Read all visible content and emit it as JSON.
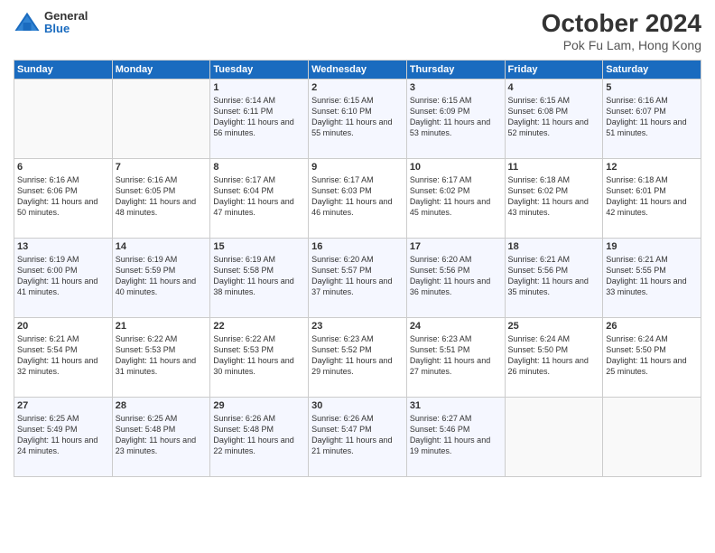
{
  "logo": {
    "general": "General",
    "blue": "Blue"
  },
  "title": "October 2024",
  "location": "Pok Fu Lam, Hong Kong",
  "days_of_week": [
    "Sunday",
    "Monday",
    "Tuesday",
    "Wednesday",
    "Thursday",
    "Friday",
    "Saturday"
  ],
  "weeks": [
    [
      {
        "day": "",
        "sunrise": "",
        "sunset": "",
        "daylight": ""
      },
      {
        "day": "",
        "sunrise": "",
        "sunset": "",
        "daylight": ""
      },
      {
        "day": "1",
        "sunrise": "Sunrise: 6:14 AM",
        "sunset": "Sunset: 6:11 PM",
        "daylight": "Daylight: 11 hours and 56 minutes."
      },
      {
        "day": "2",
        "sunrise": "Sunrise: 6:15 AM",
        "sunset": "Sunset: 6:10 PM",
        "daylight": "Daylight: 11 hours and 55 minutes."
      },
      {
        "day": "3",
        "sunrise": "Sunrise: 6:15 AM",
        "sunset": "Sunset: 6:09 PM",
        "daylight": "Daylight: 11 hours and 53 minutes."
      },
      {
        "day": "4",
        "sunrise": "Sunrise: 6:15 AM",
        "sunset": "Sunset: 6:08 PM",
        "daylight": "Daylight: 11 hours and 52 minutes."
      },
      {
        "day": "5",
        "sunrise": "Sunrise: 6:16 AM",
        "sunset": "Sunset: 6:07 PM",
        "daylight": "Daylight: 11 hours and 51 minutes."
      }
    ],
    [
      {
        "day": "6",
        "sunrise": "Sunrise: 6:16 AM",
        "sunset": "Sunset: 6:06 PM",
        "daylight": "Daylight: 11 hours and 50 minutes."
      },
      {
        "day": "7",
        "sunrise": "Sunrise: 6:16 AM",
        "sunset": "Sunset: 6:05 PM",
        "daylight": "Daylight: 11 hours and 48 minutes."
      },
      {
        "day": "8",
        "sunrise": "Sunrise: 6:17 AM",
        "sunset": "Sunset: 6:04 PM",
        "daylight": "Daylight: 11 hours and 47 minutes."
      },
      {
        "day": "9",
        "sunrise": "Sunrise: 6:17 AM",
        "sunset": "Sunset: 6:03 PM",
        "daylight": "Daylight: 11 hours and 46 minutes."
      },
      {
        "day": "10",
        "sunrise": "Sunrise: 6:17 AM",
        "sunset": "Sunset: 6:02 PM",
        "daylight": "Daylight: 11 hours and 45 minutes."
      },
      {
        "day": "11",
        "sunrise": "Sunrise: 6:18 AM",
        "sunset": "Sunset: 6:02 PM",
        "daylight": "Daylight: 11 hours and 43 minutes."
      },
      {
        "day": "12",
        "sunrise": "Sunrise: 6:18 AM",
        "sunset": "Sunset: 6:01 PM",
        "daylight": "Daylight: 11 hours and 42 minutes."
      }
    ],
    [
      {
        "day": "13",
        "sunrise": "Sunrise: 6:19 AM",
        "sunset": "Sunset: 6:00 PM",
        "daylight": "Daylight: 11 hours and 41 minutes."
      },
      {
        "day": "14",
        "sunrise": "Sunrise: 6:19 AM",
        "sunset": "Sunset: 5:59 PM",
        "daylight": "Daylight: 11 hours and 40 minutes."
      },
      {
        "day": "15",
        "sunrise": "Sunrise: 6:19 AM",
        "sunset": "Sunset: 5:58 PM",
        "daylight": "Daylight: 11 hours and 38 minutes."
      },
      {
        "day": "16",
        "sunrise": "Sunrise: 6:20 AM",
        "sunset": "Sunset: 5:57 PM",
        "daylight": "Daylight: 11 hours and 37 minutes."
      },
      {
        "day": "17",
        "sunrise": "Sunrise: 6:20 AM",
        "sunset": "Sunset: 5:56 PM",
        "daylight": "Daylight: 11 hours and 36 minutes."
      },
      {
        "day": "18",
        "sunrise": "Sunrise: 6:21 AM",
        "sunset": "Sunset: 5:56 PM",
        "daylight": "Daylight: 11 hours and 35 minutes."
      },
      {
        "day": "19",
        "sunrise": "Sunrise: 6:21 AM",
        "sunset": "Sunset: 5:55 PM",
        "daylight": "Daylight: 11 hours and 33 minutes."
      }
    ],
    [
      {
        "day": "20",
        "sunrise": "Sunrise: 6:21 AM",
        "sunset": "Sunset: 5:54 PM",
        "daylight": "Daylight: 11 hours and 32 minutes."
      },
      {
        "day": "21",
        "sunrise": "Sunrise: 6:22 AM",
        "sunset": "Sunset: 5:53 PM",
        "daylight": "Daylight: 11 hours and 31 minutes."
      },
      {
        "day": "22",
        "sunrise": "Sunrise: 6:22 AM",
        "sunset": "Sunset: 5:53 PM",
        "daylight": "Daylight: 11 hours and 30 minutes."
      },
      {
        "day": "23",
        "sunrise": "Sunrise: 6:23 AM",
        "sunset": "Sunset: 5:52 PM",
        "daylight": "Daylight: 11 hours and 29 minutes."
      },
      {
        "day": "24",
        "sunrise": "Sunrise: 6:23 AM",
        "sunset": "Sunset: 5:51 PM",
        "daylight": "Daylight: 11 hours and 27 minutes."
      },
      {
        "day": "25",
        "sunrise": "Sunrise: 6:24 AM",
        "sunset": "Sunset: 5:50 PM",
        "daylight": "Daylight: 11 hours and 26 minutes."
      },
      {
        "day": "26",
        "sunrise": "Sunrise: 6:24 AM",
        "sunset": "Sunset: 5:50 PM",
        "daylight": "Daylight: 11 hours and 25 minutes."
      }
    ],
    [
      {
        "day": "27",
        "sunrise": "Sunrise: 6:25 AM",
        "sunset": "Sunset: 5:49 PM",
        "daylight": "Daylight: 11 hours and 24 minutes."
      },
      {
        "day": "28",
        "sunrise": "Sunrise: 6:25 AM",
        "sunset": "Sunset: 5:48 PM",
        "daylight": "Daylight: 11 hours and 23 minutes."
      },
      {
        "day": "29",
        "sunrise": "Sunrise: 6:26 AM",
        "sunset": "Sunset: 5:48 PM",
        "daylight": "Daylight: 11 hours and 22 minutes."
      },
      {
        "day": "30",
        "sunrise": "Sunrise: 6:26 AM",
        "sunset": "Sunset: 5:47 PM",
        "daylight": "Daylight: 11 hours and 21 minutes."
      },
      {
        "day": "31",
        "sunrise": "Sunrise: 6:27 AM",
        "sunset": "Sunset: 5:46 PM",
        "daylight": "Daylight: 11 hours and 19 minutes."
      },
      {
        "day": "",
        "sunrise": "",
        "sunset": "",
        "daylight": ""
      },
      {
        "day": "",
        "sunrise": "",
        "sunset": "",
        "daylight": ""
      }
    ]
  ]
}
